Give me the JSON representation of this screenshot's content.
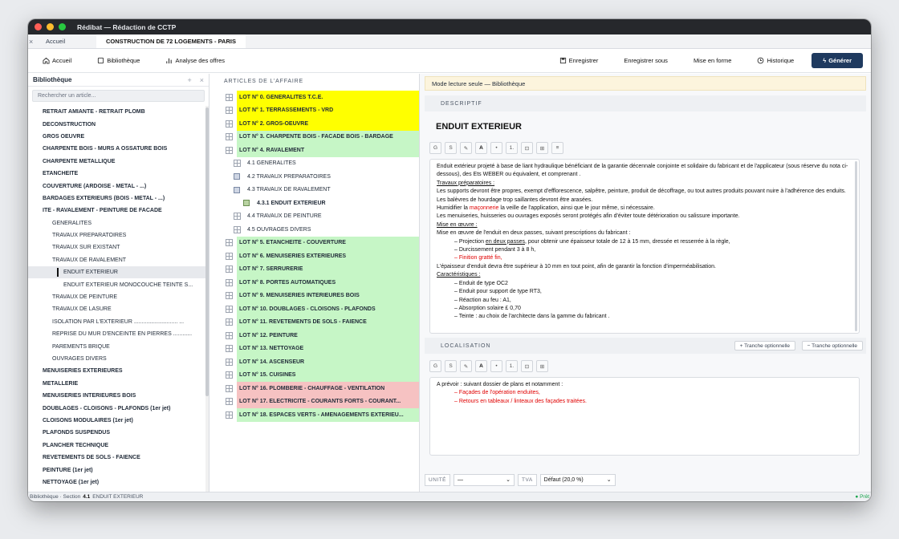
{
  "window": {
    "title": "Rédibat — Rédaction de CCTP"
  },
  "tabs": [
    {
      "label": "Accueil"
    },
    {
      "label": "CONSTRUCTION DE 72 LOGEMENTS - PARIS"
    }
  ],
  "toolbar": {
    "accueil": "Accueil",
    "bibliotheque": "Bibliothèque",
    "analyse": "Analyse des offres",
    "enregistrer": "Enregistrer",
    "enregistrer_sous": "Enregistrer sous",
    "mise_en_forme": "Mise en forme",
    "historique": "Historique",
    "generer": "Générer"
  },
  "library": {
    "title": "Bibliothèque",
    "plus": "+",
    "close": "×",
    "search_placeholder": "Rechercher un article...",
    "items": [
      {
        "label": "RETRAIT AMIANTE - RETRAIT PLOMB",
        "level": 0
      },
      {
        "label": "DECONSTRUCTION",
        "level": 0
      },
      {
        "label": "GROS OEUVRE",
        "level": 0
      },
      {
        "label": "CHARPENTE BOIS - MURS A OSSATURE BOIS",
        "level": 0
      },
      {
        "label": "CHARPENTE METALLIQUE",
        "level": 0
      },
      {
        "label": "ETANCHEITE",
        "level": 0
      },
      {
        "label": "COUVERTURE (ARDOISE - METAL - ...)",
        "level": 0
      },
      {
        "label": "BARDAGES EXTERIEURS (BOIS - METAL - ...)",
        "level": 0
      },
      {
        "label": "ITE - RAVALEMENT - PEINTURE DE FACADE",
        "level": 0
      },
      {
        "label": "GENERALITES",
        "level": 1
      },
      {
        "label": "TRAVAUX PREPARATOIRES",
        "level": 1
      },
      {
        "label": "TRAVAUX SUR EXISTANT",
        "level": 1
      },
      {
        "label": "TRAVAUX DE RAVALEMENT",
        "level": 1
      },
      {
        "label": "ENDUIT EXTERIEUR",
        "level": 2,
        "selected": true
      },
      {
        "label": "ENDUIT EXTERIEUR MONOCOUCHE TEINTE S...",
        "level": 2
      },
      {
        "label": "TRAVAUX DE PEINTURE",
        "level": 1
      },
      {
        "label": "TRAVAUX DE LASURE",
        "level": 1
      },
      {
        "label": "ISOLATION PAR L'EXTERIEUR  ............................ ...",
        "level": 1
      },
      {
        "label": "REPRISE DU MUR D'ENCEINTE EN PIERRES  ............",
        "level": 1
      },
      {
        "label": "PAREMENTS BRIQUE",
        "level": 1
      },
      {
        "label": "OUVRAGES DIVERS",
        "level": 1
      },
      {
        "label": "MENUISERIES EXTERIEURES",
        "level": 0
      },
      {
        "label": "METALLERIE",
        "level": 0
      },
      {
        "label": "MENUISERIES INTERIEURES BOIS",
        "level": 0
      },
      {
        "label": "DOUBLAGES - CLOISONS - PLAFONDS (1er jet)",
        "level": 0
      },
      {
        "label": "CLOISONS MODULAIRES (1er jet)",
        "level": 0
      },
      {
        "label": "PLAFONDS SUSPENDUS",
        "level": 0
      },
      {
        "label": "PLANCHER TECHNIQUE",
        "level": 0
      },
      {
        "label": "REVETEMENTS DE SOLS - FAIENCE",
        "level": 0
      },
      {
        "label": "PEINTURE (1er jet)",
        "level": 0
      },
      {
        "label": "NETTOYAGE (1er jet)",
        "level": 0
      }
    ]
  },
  "articles": {
    "title": "ARTICLES DE L'AFFAIRE",
    "rows": [
      {
        "label": "LOT N° 0. GENERALITES T.C.E.",
        "kind": "y"
      },
      {
        "label": "LOT N° 1. TERRASSEMENTS - VRD",
        "kind": "y"
      },
      {
        "label": "LOT N° 2. GROS-OEUVRE",
        "kind": "y"
      },
      {
        "label": "LOT N° 3. CHARPENTE BOIS - FACADE BOIS - BARDAGE",
        "kind": "g"
      },
      {
        "label": "LOT N° 4. RAVALEMENT",
        "kind": "g"
      },
      {
        "label": "4.1 GENERALITES",
        "kind": "sub",
        "icon": "plus"
      },
      {
        "label": "4.2 TRAVAUX PREPARATOIRES",
        "kind": "sub",
        "icon": "doc"
      },
      {
        "label": "4.3 TRAVAUX DE RAVALEMENT",
        "kind": "sub",
        "icon": "doc"
      },
      {
        "label": "4.3.1 ENDUIT EXTERIEUR",
        "kind": "sub2",
        "icon": "doc"
      },
      {
        "label": "4.4 TRAVAUX DE PEINTURE",
        "kind": "sub",
        "icon": "plus"
      },
      {
        "label": "4.5 OUVRAGES DIVERS",
        "kind": "sub",
        "icon": "plus"
      },
      {
        "label": "LOT N° 5. ETANCHEITE - COUVERTURE",
        "kind": "g"
      },
      {
        "label": "LOT N° 6. MENUISERIES EXTERIEURES",
        "kind": "g"
      },
      {
        "label": "LOT N° 7. SERRURERIE",
        "kind": "g"
      },
      {
        "label": "LOT N° 8. PORTES AUTOMATIQUES",
        "kind": "g"
      },
      {
        "label": "LOT N° 9. MENUISERIES INTERIEURES BOIS",
        "kind": "g"
      },
      {
        "label": "LOT N° 10. DOUBLAGES - CLOISONS - PLAFONDS",
        "kind": "g"
      },
      {
        "label": "LOT N° 11. REVETEMENTS DE SOLS - FAIENCE",
        "kind": "g"
      },
      {
        "label": "LOT N° 12. PEINTURE",
        "kind": "g"
      },
      {
        "label": "LOT N° 13. NETTOYAGE",
        "kind": "g"
      },
      {
        "label": "LOT N° 14. ASCENSEUR",
        "kind": "g"
      },
      {
        "label": "LOT N° 15. CUISINES",
        "kind": "g"
      },
      {
        "label": "LOT N° 16. PLOMBERIE - CHAUFFAGE - VENTILATION",
        "kind": "rd"
      },
      {
        "label": "LOT N° 17. ELECTRICITE - COURANTS FORTS - COURANT...",
        "kind": "rd"
      },
      {
        "label": "LOT N° 18. ESPACES VERTS - AMENAGEMENTS EXTERIEU...",
        "kind": "g"
      }
    ]
  },
  "editor": {
    "banner": "Mode lecture seule — Bibliothèque",
    "descriptif_label": "DESCRIPTIF",
    "title": "ENDUIT EXTERIEUR",
    "format_buttons": [
      "G",
      "S",
      "✎",
      "A",
      "•",
      "1.",
      "⊡",
      "⊞",
      "≡"
    ],
    "descriptif": [
      {
        "t": "Enduit extérieur projeté à base de liant hydraulique bénéficiant de la garantie décennale conjointe et solidaire du fabricant et de l'applicateur (sous réserve du nota ci-dessous), des Ets WEBER ou équivalent, et comprenant ."
      },
      {
        "t": "Travaux préparatoires :",
        "u": true
      },
      {
        "t": "Les supports devront être propres, exempt d'efflorescence, salpêtre, peinture, produit de décoffrage, ou tout autres produits pouvant nuire à l'adhérence des enduits."
      },
      {
        "t": "Les balèvres de hourdage trop saillantes devront être arasées."
      },
      {
        "t": "Humidifier la ",
        "r": "maçonnerie",
        "t2": " la veille de l'application, ainsi que le jour même, si nécessaire."
      },
      {
        "t": "Les menuiseries, huisseries ou ouvrages exposés seront protégés afin d'éviter toute détérioration ou salissure importante."
      },
      {
        "t": "Mise en œuvre :",
        "u": true
      },
      {
        "t": "Mise en œuvre de l'enduit en deux passes, suivant prescriptions du fabricant :"
      },
      {
        "t": "– Projection ",
        "uu": "en deux passes",
        "t2": ", pour obtenir une épaisseur totale de 12 à 15 mm, dressée et resserrée à la règle,",
        "ind": true
      },
      {
        "t": "– Durcissement pendant 3 à 8 h,",
        "ind": true
      },
      {
        "t": "– Finition gratté fin,",
        "ind": true,
        "red": true
      },
      {
        "t": "L'épaisseur d'enduit devra être supérieur à 10 mm en tout point, afin de garantir la fonction d'imperméabilisation."
      },
      {
        "t": "Caractéristiques :",
        "u": true
      },
      {
        "t": "– Enduit de type OC2",
        "ind": true
      },
      {
        "t": "– Enduit pour support de type RT3,",
        "ind": true
      },
      {
        "t": "– Réaction au feu : A1,",
        "ind": true
      },
      {
        "t": "– Absorption solaire £ 0,70",
        "ind": true
      },
      {
        "t": "– Teinte : au choix de l'architecte dans la gamme du fabricant .",
        "ind": true
      }
    ],
    "localisation_label": "LOCALISATION",
    "tranche_add": "+ Tranche optionnelle",
    "tranche_remove": "− Tranche optionnelle",
    "format_buttons2": [
      "G",
      "S",
      "✎",
      "A",
      "•",
      "1.",
      "⊡",
      "⊞"
    ],
    "localisation": [
      {
        "t": "A prévoir : suivant dossier de plans et notamment :"
      },
      {
        "t": "– Façades de l'opération enduites,",
        "ind": true,
        "red": true
      },
      {
        "t": "– Retours en tableaux / linteaux des façades traitées.",
        "ind": true,
        "red": true
      }
    ],
    "unite_label": "UNITÉ",
    "unite_value": "—",
    "tva_label": "TVA",
    "tva_value": "Défaut (20,0 %)"
  },
  "status": {
    "prefix": "Bibliothèque · Section",
    "section": "4.1",
    "article": "ENDUIT EXTERIEUR",
    "ready": "● Prêt"
  }
}
